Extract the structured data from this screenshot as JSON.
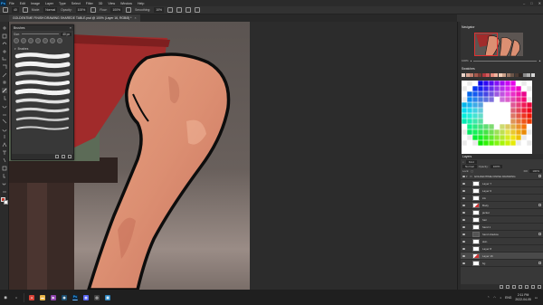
{
  "app": {
    "logo": "Ps",
    "menu": [
      "File",
      "Edit",
      "Image",
      "Layer",
      "Type",
      "Select",
      "Filter",
      "3D",
      "View",
      "Window",
      "Help"
    ],
    "window_controls": {
      "minimize": "–",
      "maximize": "□",
      "close": "✕"
    }
  },
  "options_bar": {
    "size_value": "40",
    "mode_label": "Mode:",
    "mode_value": "Normal",
    "opacity_label": "Opacity:",
    "opacity_value": "100%",
    "flow_label": "Flow:",
    "flow_value": "100%",
    "smoothing_label": "Smoothing:",
    "smoothing_value": "10%"
  },
  "document": {
    "tab_title": "GOLDENTIME FINISH DRAWING SHAREDE TABLE.psd @ 100% (Layer 16, RGB/8) *",
    "close": "×"
  },
  "brushes_panel": {
    "title": "Brushes",
    "size_label": "Size:",
    "size_value": "40 px",
    "folder_label": "Brushes",
    "menu": "≡"
  },
  "navigator": {
    "title": "Navigator",
    "zoom": "100%"
  },
  "swatches": {
    "title": "Swatches",
    "colors": [
      "#e8d2c8",
      "#d9a796",
      "#c47f6e",
      "#a55a4d",
      "#7a3b34",
      "#b5393f",
      "#d25b5b",
      "#e58a7c",
      "#f0b49e",
      "#f5cfb8",
      "#c9a08a",
      "#9b7866",
      "#6c5548",
      "#4a3a33",
      "#2d2522",
      "#8a8a8a",
      "#b0b0b0",
      "#d7d7d7"
    ]
  },
  "layers_panel": {
    "title": "Layers",
    "kind_label": "Kind",
    "blend_mode": "Normal",
    "opacity_label": "Opacity:",
    "opacity_value": "100%",
    "lock_label": "Lock:",
    "fill_label": "Fill:",
    "fill_value": "100%",
    "layers": [
      {
        "name": "GOLDENTIME FINISH DRAWING",
        "type": "group",
        "thumb": "white",
        "active": false
      },
      {
        "name": "Layer 7",
        "type": "layer",
        "thumb": "white",
        "active": false
      },
      {
        "name": "Layer 6",
        "type": "layer",
        "thumb": "white",
        "active": false
      },
      {
        "name": "ink",
        "type": "layer",
        "thumb": "white",
        "active": false
      },
      {
        "name": "Body",
        "type": "layer",
        "thumb": "mixed",
        "active": false
      },
      {
        "name": "jacket",
        "type": "layer",
        "thumb": "white",
        "active": false
      },
      {
        "name": "hair",
        "type": "layer",
        "thumb": "white",
        "active": false
      },
      {
        "name": "hand 1",
        "type": "layer",
        "thumb": "white",
        "active": false
      },
      {
        "name": "hand shadow",
        "type": "layer",
        "thumb": "dark",
        "active": false
      },
      {
        "name": "skin",
        "type": "layer",
        "thumb": "white",
        "active": false
      },
      {
        "name": "Layer 8",
        "type": "layer",
        "thumb": "white",
        "active": false
      },
      {
        "name": "Layer 16",
        "type": "layer",
        "thumb": "mixed",
        "active": true
      },
      {
        "name": "bg",
        "type": "layer",
        "thumb": "white",
        "active": false
      }
    ]
  },
  "taskbar": {
    "apps": [
      {
        "name": "start",
        "glyph": "⊞",
        "color": "#1f1f1f"
      },
      {
        "name": "search",
        "glyph": "○",
        "color": "#1f1f1f"
      },
      {
        "name": "chrome",
        "glyph": "●",
        "color": "#db4437"
      },
      {
        "name": "files",
        "glyph": "▬",
        "color": "#e8b64a"
      },
      {
        "name": "media",
        "glyph": "▶",
        "color": "#8e44ad"
      },
      {
        "name": "steam",
        "glyph": "◉",
        "color": "#1b4f72"
      },
      {
        "name": "photoshop",
        "glyph": "Ps",
        "color": "#0b2c49"
      },
      {
        "name": "discord",
        "glyph": "◍",
        "color": "#5865f2"
      },
      {
        "name": "obs",
        "glyph": "◎",
        "color": "#444444"
      },
      {
        "name": "app-9",
        "glyph": "▣",
        "color": "#2e86c1"
      }
    ],
    "tray": {
      "lang": "ENG",
      "time": "2:11 PM",
      "date": "2022-04-05"
    }
  }
}
